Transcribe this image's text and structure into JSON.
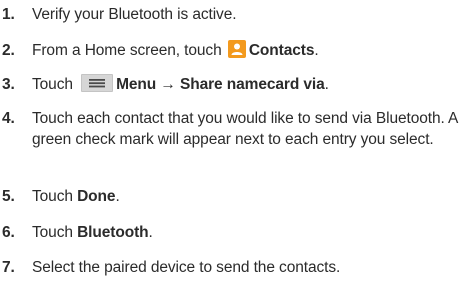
{
  "steps": [
    {
      "number": "1.",
      "text": "Verify your Bluetooth is active."
    },
    {
      "number": "2.",
      "pre": "From a Home screen, touch",
      "bold": "Contacts",
      "post": ".",
      "icon": "contacts-icon"
    },
    {
      "number": "3.",
      "pre": "Touch",
      "icon": "menu-icon",
      "bold": "Menu → Share namecard via",
      "post": "."
    },
    {
      "number": "4.",
      "text": "Touch each contact that you would like to send via Bluetooth. A green check mark will appear next to each entry you select."
    },
    {
      "number": "5.",
      "pre": "Touch",
      "bold": "Done",
      "post": "."
    },
    {
      "number": "6.",
      "pre": "Touch",
      "bold": "Bluetooth",
      "post": "."
    },
    {
      "number": "7.",
      "text": "Select the paired device to send the contacts."
    }
  ],
  "colors": {
    "text": "#2b2b2b",
    "contacts_icon": "#f39a1e",
    "menu_icon_bg": "#d6d6d6",
    "menu_icon_lines": "#4a4a4a"
  }
}
